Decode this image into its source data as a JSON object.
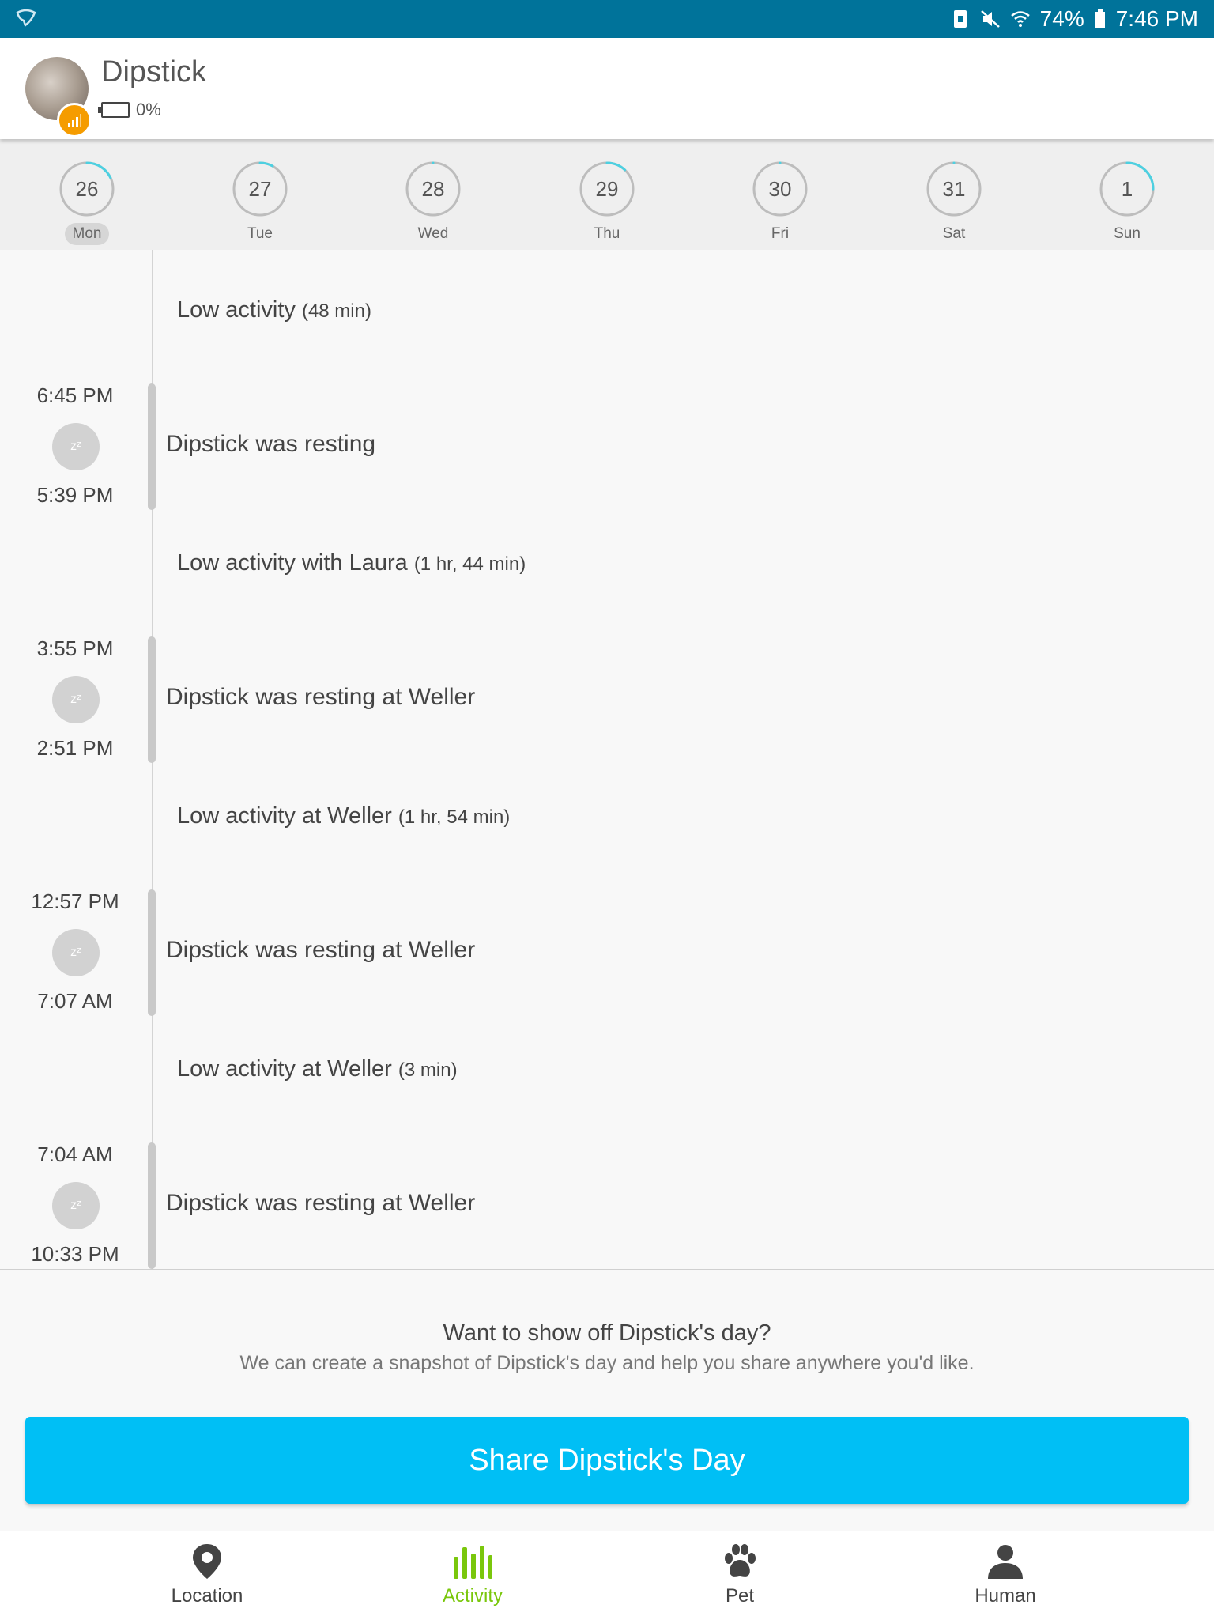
{
  "status_bar": {
    "battery_percent": "74%",
    "time": "7:46 PM",
    "icons": [
      "app-icon",
      "sd-card-icon",
      "mute-icon",
      "wifi-icon",
      "battery-icon"
    ]
  },
  "header": {
    "pet_name": "Dipstick",
    "battery_level": "0%"
  },
  "week": {
    "days": [
      {
        "num": "26",
        "label": "Mon",
        "progress": 0.18,
        "active": true
      },
      {
        "num": "27",
        "label": "Tue",
        "progress": 0.08,
        "active": false
      },
      {
        "num": "28",
        "label": "Wed",
        "progress": 0.0,
        "active": false
      },
      {
        "num": "29",
        "label": "Thu",
        "progress": 0.12,
        "active": false
      },
      {
        "num": "30",
        "label": "Fri",
        "progress": 0.0,
        "active": false
      },
      {
        "num": "31",
        "label": "Sat",
        "progress": 0.0,
        "active": false
      },
      {
        "num": "1",
        "label": "Sun",
        "progress": 0.25,
        "active": false
      }
    ],
    "accent_color": "#4dd0e1"
  },
  "timeline": {
    "entries": [
      {
        "type": "activity",
        "text": "Low activity",
        "duration": "(48 min)"
      },
      {
        "type": "rest",
        "text": "Dipstick was resting",
        "start": "6:45 PM",
        "end": "5:39 PM"
      },
      {
        "type": "activity",
        "text": "Low activity with Laura",
        "duration": "(1 hr, 44 min)"
      },
      {
        "type": "rest",
        "text": "Dipstick was resting at Weller",
        "start": "3:55 PM",
        "end": "2:51 PM"
      },
      {
        "type": "activity",
        "text": "Low activity at Weller",
        "duration": "(1 hr, 54 min)"
      },
      {
        "type": "rest",
        "text": "Dipstick was resting at Weller",
        "start": "12:57 PM",
        "end": "7:07 AM"
      },
      {
        "type": "activity",
        "text": "Low activity at Weller",
        "duration": "(3 min)"
      },
      {
        "type": "rest",
        "text": "Dipstick was resting at Weller",
        "start": "7:04 AM",
        "end": "10:33 PM"
      }
    ]
  },
  "share": {
    "title": "Want to show off Dipstick's day?",
    "subtitle": "We can create a snapshot of Dipstick's day and help you share anywhere you'd like.",
    "button_label": "Share Dipstick's Day",
    "button_color": "#00bff5"
  },
  "bottom_nav": {
    "items": [
      {
        "label": "Location",
        "icon": "location-pin-icon"
      },
      {
        "label": "Activity",
        "icon": "activity-bars-icon",
        "active": true
      },
      {
        "label": "Pet",
        "icon": "paw-icon"
      },
      {
        "label": "Human",
        "icon": "person-icon"
      }
    ],
    "active_color": "#7ac70c"
  }
}
